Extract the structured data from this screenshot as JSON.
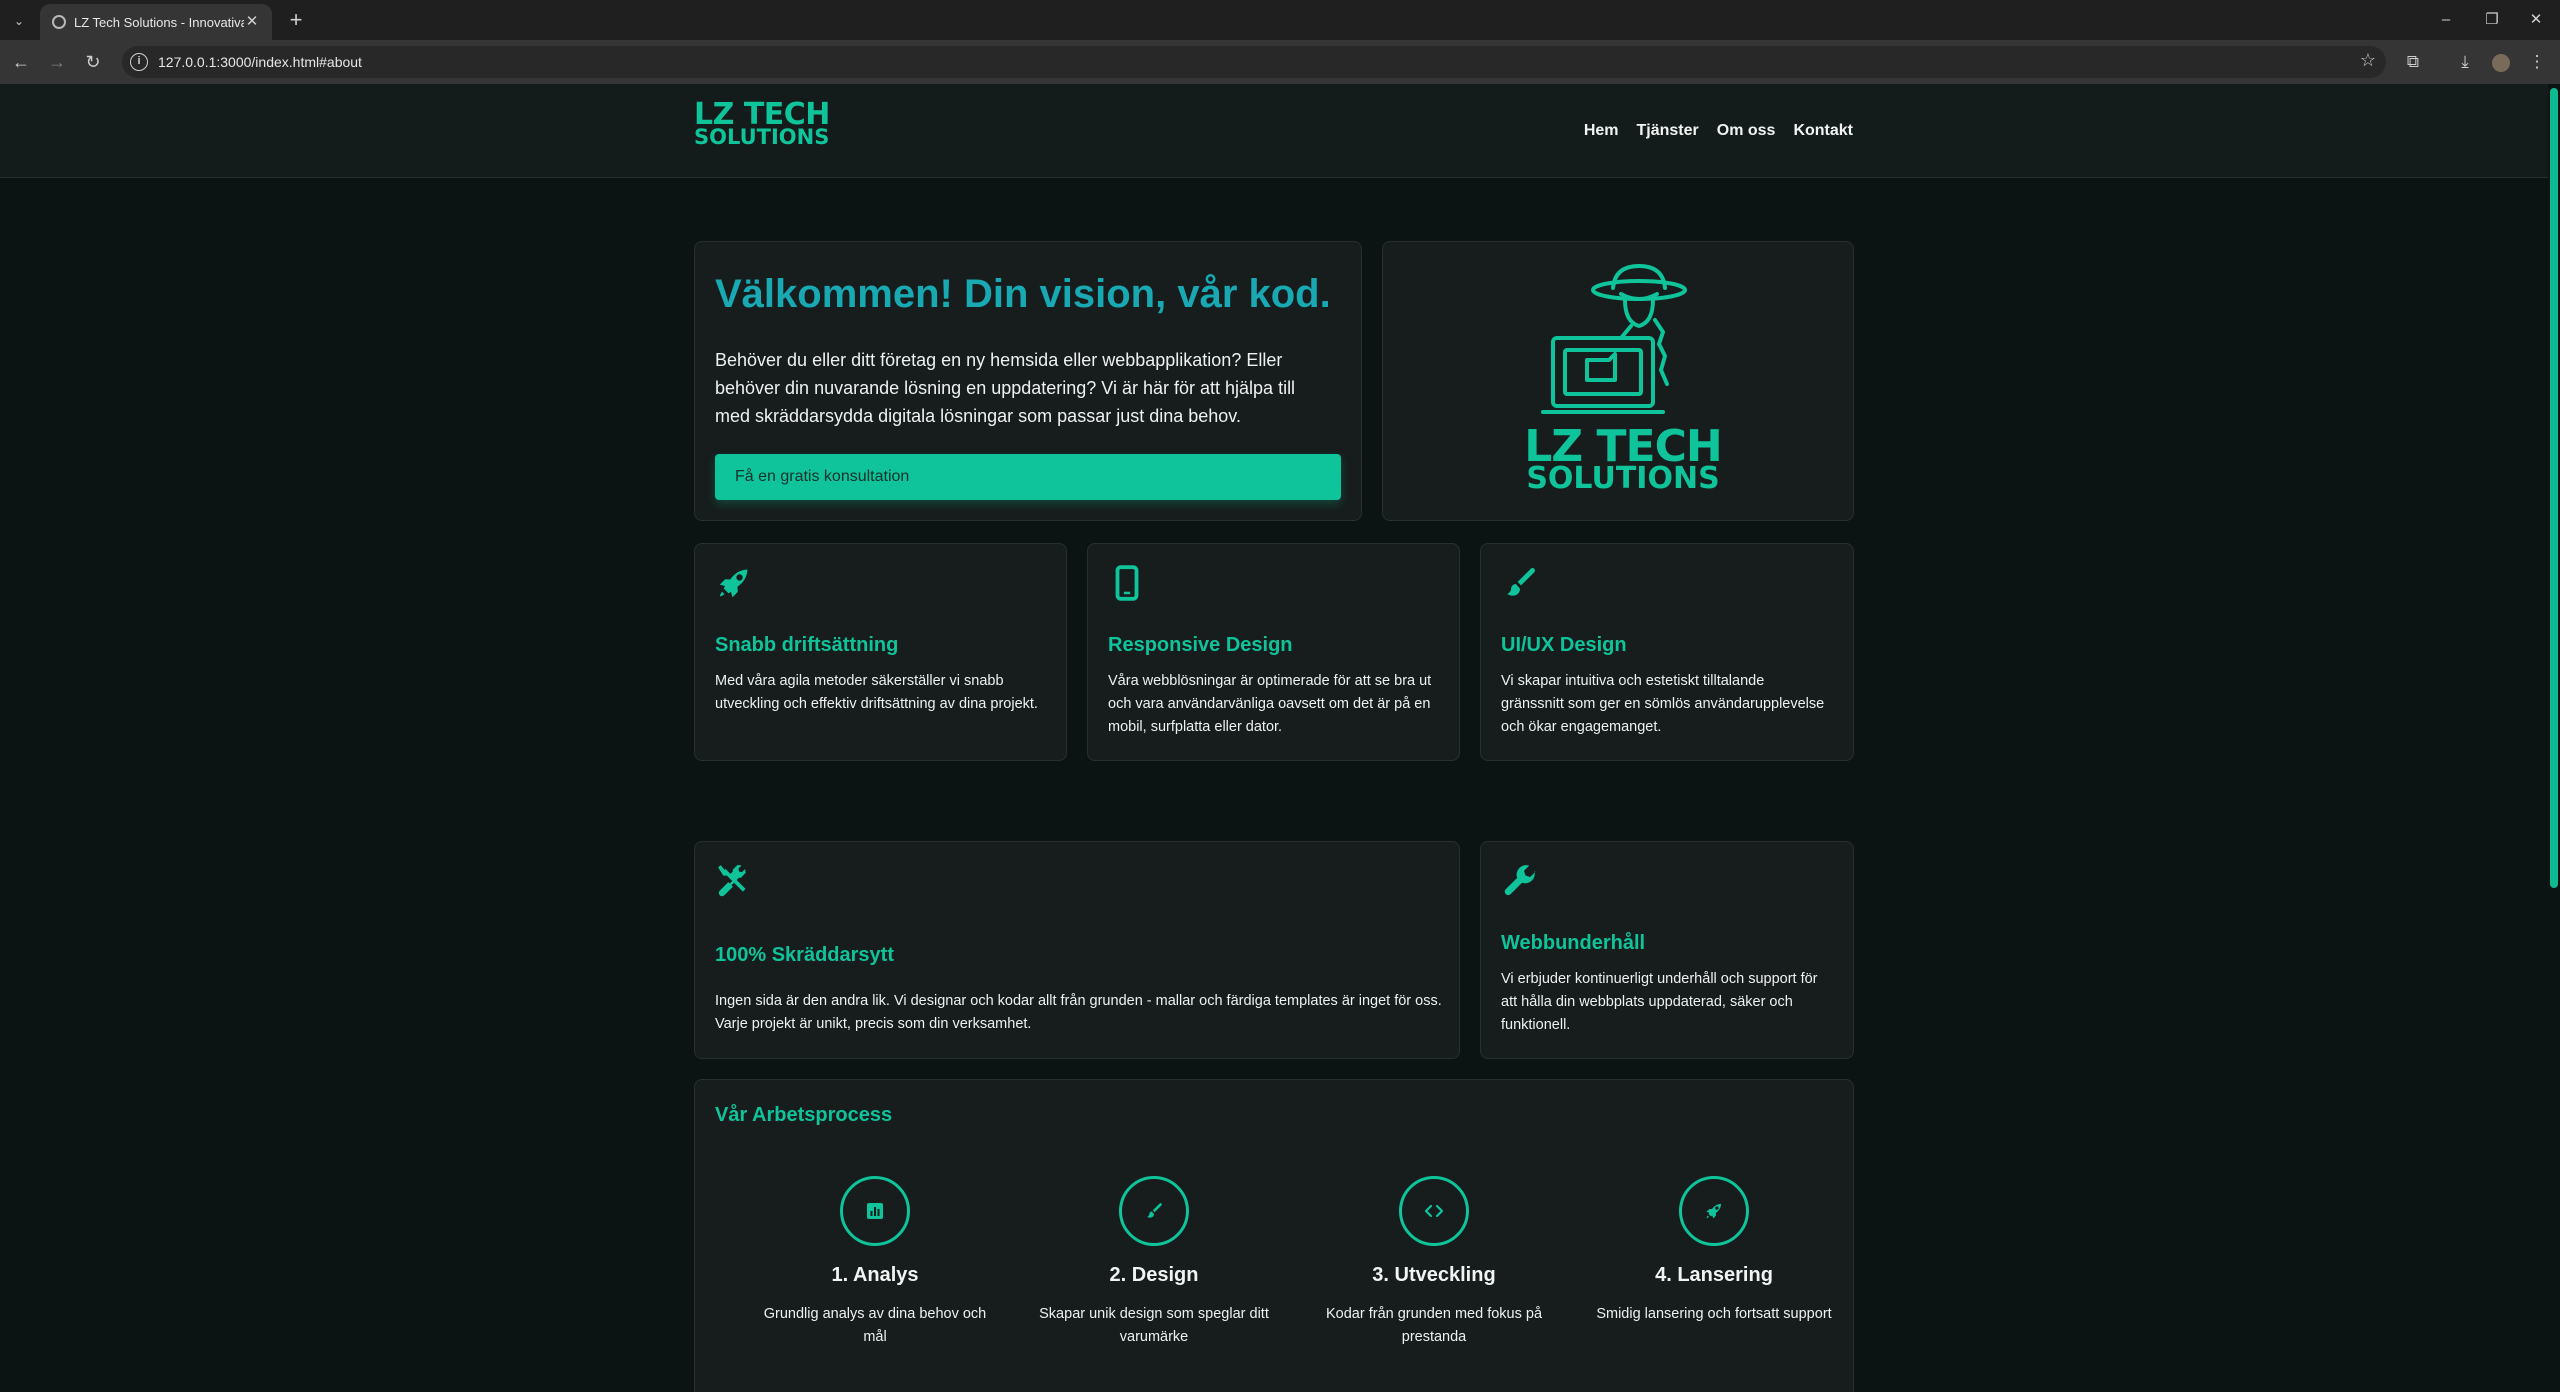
{
  "browser": {
    "tab_title": "LZ Tech Solutions - Innovativa W",
    "url": "127.0.0.1:3000/index.html#about"
  },
  "header": {
    "logo_line1": "LZ TECH",
    "logo_line2": "SOLUTIONS",
    "nav": [
      "Hem",
      "Tjänster",
      "Om oss",
      "Kontakt"
    ]
  },
  "hero": {
    "title": "Välkommen! Din vision, vår kod.",
    "text": "Behöver du eller ditt företag en ny hemsida eller webbapplikation? Eller behöver din nuvarande lösning en uppdatering? Vi är här för att hjälpa till med skräddarsydda digitala lösningar som passar just dina behov.",
    "cta": "Få en gratis konsultation",
    "logo_line1": "LZ TECH",
    "logo_line2": "SOLUTIONS"
  },
  "features": [
    {
      "icon": "rocket-icon",
      "title": "Snabb driftsättning",
      "text": "Med våra agila metoder säkerställer vi snabb utveckling och effektiv driftsättning av dina projekt."
    },
    {
      "icon": "mobile-icon",
      "title": "Responsive Design",
      "text": "Våra webblösningar är optimerade för att se bra ut och vara användarvänliga oavsett om det är på en mobil, surfplatta eller dator."
    },
    {
      "icon": "brush-icon",
      "title": "UI/UX Design",
      "text": "Vi skapar intuitiva och estetiskt tilltalande gränssnitt som ger en sömlös användarupplevelse och ökar engagemanget."
    },
    {
      "icon": "tools-icon",
      "title": "100% Skräddarsytt",
      "text": "Ingen sida är den andra lik. Vi designar och kodar allt från grunden - mallar och färdiga templates är inget för oss. Varje projekt är unikt, precis som din verksamhet."
    },
    {
      "icon": "wrench-icon",
      "title": "Webbunderhåll",
      "text": "Vi erbjuder kontinuerligt underhåll och support för att hålla din webbplats uppdaterad, säker och funktionell."
    }
  ],
  "process": {
    "title": "Vår Arbetsprocess",
    "steps": [
      {
        "icon": "chart-icon",
        "title": "1. Analys",
        "text": "Grundlig analys av dina behov och mål"
      },
      {
        "icon": "brush-icon",
        "title": "2. Design",
        "text": "Skapar unik design som speglar ditt varumärke"
      },
      {
        "icon": "code-icon",
        "title": "3. Utveckling",
        "text": "Kodar från grunden med fokus på prestanda"
      },
      {
        "icon": "rocket-icon",
        "title": "4. Lansering",
        "text": "Smidig lansering och fortsatt support"
      }
    ]
  },
  "colors": {
    "accent": "#0fc39b",
    "hero_title": "#18a9b3",
    "background": "#0c1413",
    "card": "#161d1c"
  }
}
